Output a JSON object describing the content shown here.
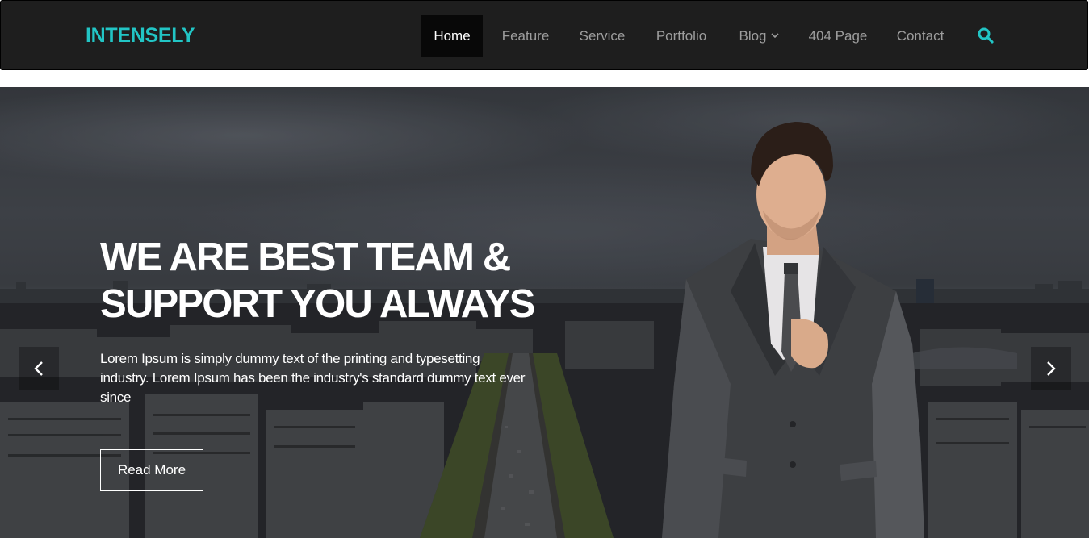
{
  "brand": {
    "name": "INTENSELY",
    "color": "#22c5c5"
  },
  "nav": {
    "items": [
      {
        "label": "Home",
        "active": true
      },
      {
        "label": "Feature"
      },
      {
        "label": "Service"
      },
      {
        "label": "Portfolio"
      },
      {
        "label": "Blog",
        "dropdown": true
      },
      {
        "label": "404 Page"
      },
      {
        "label": "Contact"
      }
    ],
    "search_icon": "search-icon"
  },
  "hero": {
    "headline_line1": "WE ARE BEST TEAM &",
    "headline_line2": "SUPPORT YOU ALWAYS",
    "description": "Lorem Ipsum is simply dummy text of the printing and typesetting industry. Lorem Ipsum has been the industry's standard dummy text ever since",
    "button_label": "Read More",
    "prev_icon": "chevron-left-icon",
    "next_icon": "chevron-right-icon"
  },
  "colors": {
    "accent": "#22c5c5",
    "navbar_bg": "#1e1e1e",
    "nav_active_bg": "#080808",
    "nav_text": "#9d9d9d"
  }
}
